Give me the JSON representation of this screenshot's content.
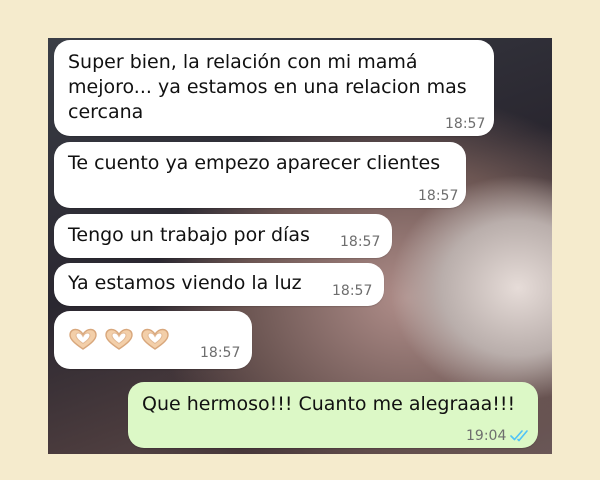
{
  "messages": [
    {
      "text": "Super bien, la relación con mi mamá\nmejoro... ya estamos en una relacion mas\ncercana",
      "time": "18:57"
    },
    {
      "text": "Te cuento ya empezo aparecer clientes",
      "time": "18:57"
    },
    {
      "text": "Tengo un trabajo por días",
      "time": "18:57"
    },
    {
      "text": "Ya estamos viendo la luz",
      "time": "18:57"
    },
    {
      "emoji": "hand-heart-icon",
      "time": "18:57"
    },
    {
      "text": "Que hermoso!!! Cuanto me alegraaa!!!",
      "time": "19:04",
      "status": "read-double-check-icon"
    }
  ],
  "colors": {
    "incoming_bubble": "#ffffff",
    "outgoing_bubble": "#dcf8c6",
    "read_ticks": "#4fc3f7",
    "page_background": "#f5ebcd"
  }
}
